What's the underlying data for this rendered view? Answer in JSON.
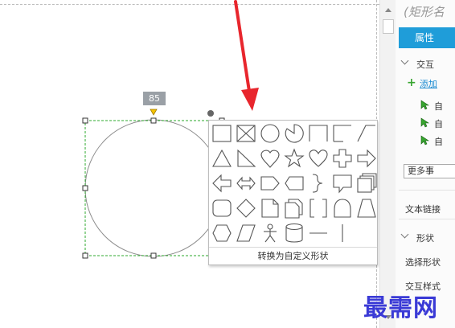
{
  "canvas": {
    "width_label": "85"
  },
  "shape_picker": {
    "shapes": [
      "rectangle",
      "rectangle-crossed",
      "ellipse",
      "pie",
      "rectangle-cut-corner",
      "rectangle-single-cut",
      "parallelogram-cut",
      "triangle",
      "right-triangle",
      "heart-drop",
      "star",
      "heart",
      "cross",
      "arrow-right",
      "arrow-left",
      "arrow-double",
      "pentagon-tag",
      "hexagon-tag",
      "brace-right",
      "callout",
      "stacked-pages",
      "rounded-rectangle",
      "diamond",
      "document",
      "multi-document",
      "brackets",
      "bell-arch",
      "trapezoid",
      "hexagon",
      "slanted-parallelogram",
      "stick-figure",
      "cylinder",
      "horizontal-line",
      "vertical-line"
    ],
    "convert_label": "转换为自定义形状"
  },
  "panel": {
    "title": "(矩形名",
    "tab_label": "属性",
    "interaction_label": "交互",
    "add_label": "添加",
    "events": [
      "自",
      "自",
      "自"
    ],
    "more_events_label": "更多事",
    "text_link_label": "文本链接",
    "shape_label": "形状",
    "select_shape_label": "选择形状",
    "interaction_style_label": "交互样式"
  },
  "watermark": "最需网",
  "colors": {
    "accent": "#1f9dd9",
    "arrow": "#e8262d",
    "selection": "#2ca82c",
    "watermark": "#3a3ad6"
  }
}
